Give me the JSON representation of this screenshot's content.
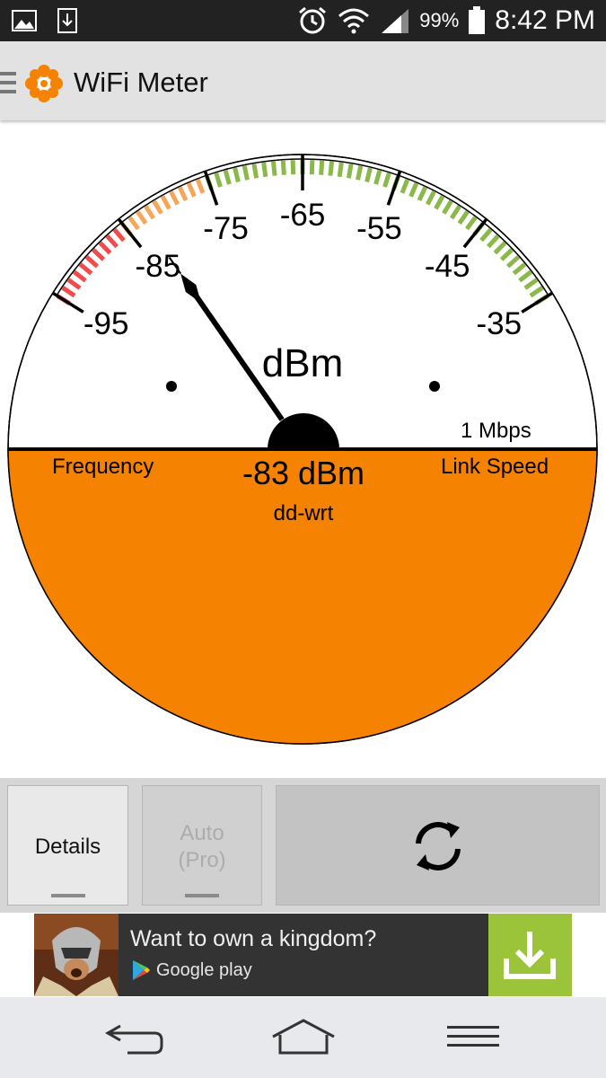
{
  "status_bar": {
    "battery": "99%",
    "time": "8:42 PM",
    "icons": [
      "image-icon",
      "download-icon",
      "alarm-icon",
      "wifi-icon",
      "signal-icon",
      "battery-icon"
    ]
  },
  "app_bar": {
    "title": "WiFi Meter",
    "icons": [
      "menu-icon",
      "app-logo-flower-icon"
    ]
  },
  "gauge": {
    "scale_labels": [
      "-95",
      "-85",
      "-75",
      "-65",
      "-55",
      "-45",
      "-35"
    ],
    "unit": "dBm",
    "reading_value": -83,
    "reading": "-83 dBm",
    "network_name": "dd-wrt",
    "link_speed_value": "1 Mbps",
    "left_caption": "Frequency",
    "right_caption": "Link Speed",
    "colors": {
      "weak": "#f24b4b",
      "fair": "#f5a65a",
      "good": "#8ab94a",
      "lower_fill": "#f58200",
      "needle": "#000000"
    }
  },
  "controls": {
    "details_label": "Details",
    "auto_label_1": "Auto",
    "auto_label_2": "(Pro)",
    "refresh_icon": "refresh-icon"
  },
  "ad": {
    "text": "Want to own a kingdom?",
    "store_name": "Google play",
    "download_icon": "download-icon",
    "colors": {
      "background": "#333333",
      "download": "#9cc43a"
    }
  },
  "nav_bar": {
    "icons": [
      "back-icon",
      "home-icon",
      "menu-icon"
    ]
  }
}
